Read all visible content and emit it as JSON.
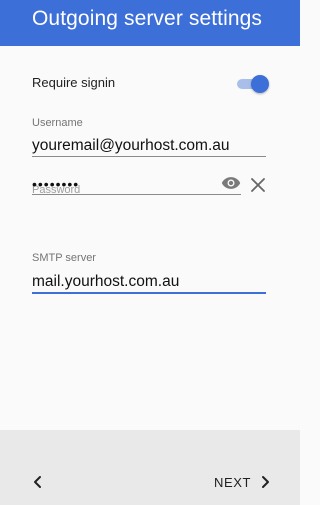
{
  "header": {
    "title": "Outgoing server settings"
  },
  "require_signin": {
    "label": "Require signin",
    "enabled": true
  },
  "username": {
    "label": "Username",
    "value": "youremail@yourhost.com.au"
  },
  "password": {
    "label": "Password",
    "masked_value": "••••••••"
  },
  "smtp": {
    "label": "SMTP server",
    "value": "mail.yourhost.com.au"
  },
  "footer": {
    "back_icon": "chevron-left-icon",
    "next_label": "NEXT",
    "next_icon": "chevron-right-icon"
  },
  "colors": {
    "accent": "#3d6fd8",
    "toggle_track": "#a9bfe9",
    "footer_bg": "#e9e9e9"
  }
}
